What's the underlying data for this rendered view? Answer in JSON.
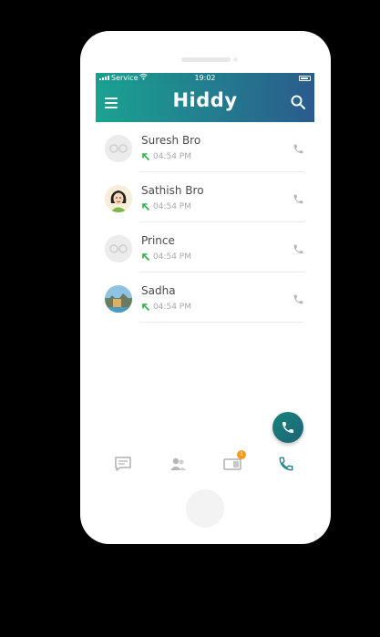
{
  "status_bar": {
    "carrier": "Service",
    "time": "19:02"
  },
  "app_bar": {
    "title": "Hiddy"
  },
  "calls": [
    {
      "name": "Suresh Bro",
      "time": "04:54 PM",
      "direction": "outgoing",
      "avatar": "default-avatar"
    },
    {
      "name": "Sathish Bro",
      "time": "04:54 PM",
      "direction": "outgoing",
      "avatar": "girl-avatar"
    },
    {
      "name": "Prince",
      "time": "04:54 PM",
      "direction": "outgoing",
      "avatar": "default-avatar"
    },
    {
      "name": "Sadha",
      "time": "04:54 PM",
      "direction": "outgoing",
      "avatar": "photo-avatar"
    }
  ],
  "bottom_nav": {
    "status_badge": "1",
    "active_tab": "calls"
  },
  "colors": {
    "brand_start": "#1aa391",
    "brand_end": "#2b5b8d",
    "outgoing_arrow": "#2fb14a",
    "badge": "#f59b1a",
    "fab": "#17837a"
  }
}
